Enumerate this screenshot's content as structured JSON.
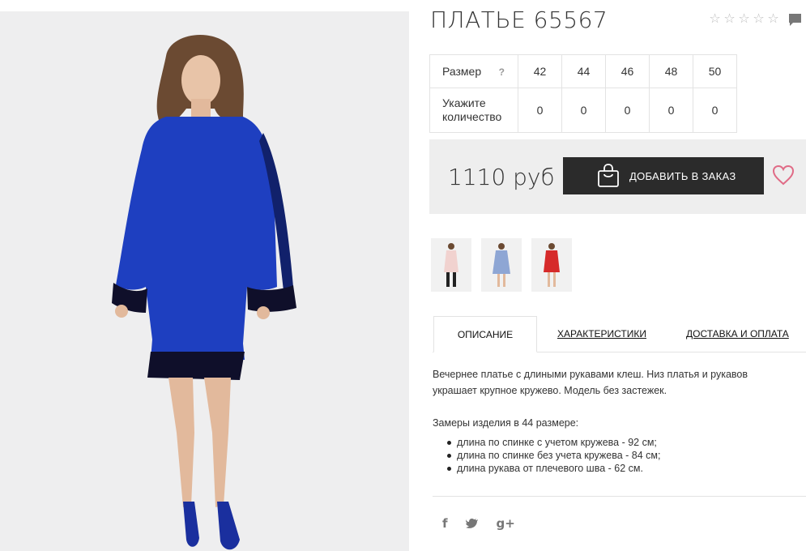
{
  "product": {
    "title": "ПЛАТЬЕ 65567",
    "rating_stars": 5,
    "price": "1110 руб"
  },
  "size_table": {
    "size_label": "Размер",
    "help_icon": "?",
    "qty_label": "Укажите количество",
    "sizes": [
      "42",
      "44",
      "46",
      "48",
      "50"
    ],
    "quantities": [
      "0",
      "0",
      "0",
      "0",
      "0"
    ]
  },
  "cart": {
    "add_label": "ДОБАВИТЬ В ЗАКАЗ",
    "icon": "shopping-bag-icon",
    "favorite_icon": "heart-icon"
  },
  "thumbnails": [
    {
      "color": "#f1d2cf",
      "name": "pink-dress-thumbnail"
    },
    {
      "color": "#8ea6d4",
      "name": "light-blue-dress-thumbnail"
    },
    {
      "color": "#d62a2a",
      "name": "red-dress-thumbnail"
    }
  ],
  "tabs": [
    {
      "label": "ОПИСАНИЕ",
      "active": true
    },
    {
      "label": "ХАРАКТЕРИСТИКИ",
      "active": false
    },
    {
      "label": "ДОСТАВКА И ОПЛАТА",
      "active": false
    }
  ],
  "description": {
    "text": "Вечернее платье с длиными рукавами клеш. Низ платья и рукавов украшает крупное кружево. Модель без застежек.",
    "measures_title": "Замеры изделия в 44 размере:",
    "measures": [
      "длина по спинке с учетом кружева - 92 см;",
      "длина по спинке без учета кружева - 84 см;",
      "длина рукава от плечевого шва - 62 см."
    ]
  },
  "social": {
    "facebook": "f",
    "twitter": "🐦",
    "googleplus": "g+"
  },
  "colors": {
    "dress_blue": "#1e3fc0",
    "button_dark": "#2b2b2b",
    "heart_pink": "#e06b86",
    "price_bg": "#eeeeee"
  }
}
